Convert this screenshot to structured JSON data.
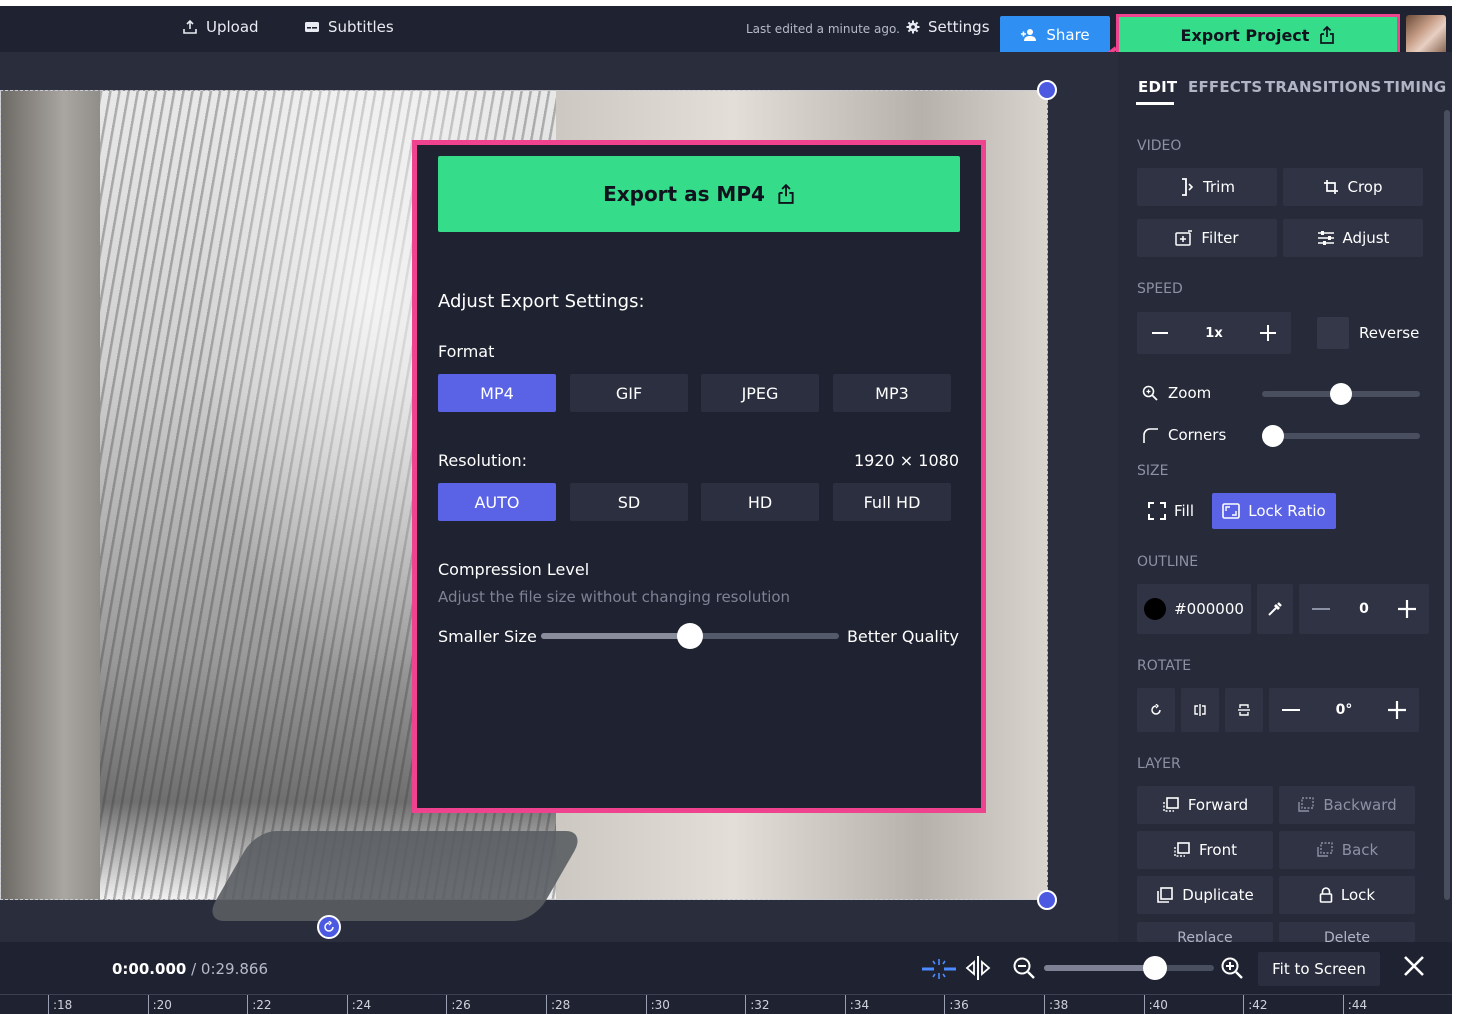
{
  "topbar": {
    "upload_label": "Upload",
    "subtitles_label": "Subtitles",
    "last_edited": "Last edited a minute ago.",
    "settings_label": "Settings",
    "share_label": "Share",
    "export_project_label": "Export Project"
  },
  "export_modal": {
    "export_button_label": "Export as MP4",
    "heading": "Adjust Export Settings:",
    "format_label": "Format",
    "formats": [
      "MP4",
      "GIF",
      "JPEG",
      "MP3"
    ],
    "format_selected": "MP4",
    "resolution_label": "Resolution:",
    "resolution_value": "1920 × 1080",
    "resolutions": [
      "AUTO",
      "SD",
      "HD",
      "Full HD"
    ],
    "resolution_selected": "AUTO",
    "compression_label": "Compression Level",
    "compression_sub": "Adjust the file size without changing resolution",
    "compression_min_label": "Smaller Size",
    "compression_max_label": "Better Quality",
    "compression_level": 0.5
  },
  "panel": {
    "tabs": [
      "EDIT",
      "EFFECTS",
      "TRANSITIONS",
      "TIMING"
    ],
    "active_tab": "EDIT",
    "video_label": "VIDEO",
    "trim_label": "Trim",
    "crop_label": "Crop",
    "filter_label": "Filter",
    "adjust_label": "Adjust",
    "speed_label": "SPEED",
    "speed_value": "1x",
    "reverse_label": "Reverse",
    "zoom_label": "Zoom",
    "zoom_level": 0.5,
    "corners_label": "Corners",
    "corners_level": 0.0,
    "size_label": "SIZE",
    "fill_label": "Fill",
    "lock_ratio_label": "Lock Ratio",
    "outline_label": "OUTLINE",
    "outline_color": "#000000",
    "outline_value": "0",
    "rotate_label": "ROTATE",
    "rotate_value": "0°",
    "layer_label": "LAYER",
    "forward_label": "Forward",
    "backward_label": "Backward",
    "front_label": "Front",
    "back_label": "Back",
    "duplicate_label": "Duplicate",
    "lock_label": "Lock",
    "replace_label": "Replace",
    "delete_label": "Delete"
  },
  "bottombar": {
    "current_time": "0:00.000",
    "total_time": " / 0:29.866",
    "fit_label": "Fit to Screen",
    "zoom_level": 0.65
  },
  "ruler": {
    "ticks": [
      ":18",
      ":20",
      ":22",
      ":24",
      ":26",
      ":28",
      ":30",
      ":32",
      ":34",
      ":36",
      ":38",
      ":40",
      ":42",
      ":44"
    ]
  },
  "colors": {
    "accent_green": "#35dc8a",
    "highlight_pink": "#f0438f",
    "selected_blue": "#5a62e6",
    "share_blue": "#2f8ff3"
  }
}
